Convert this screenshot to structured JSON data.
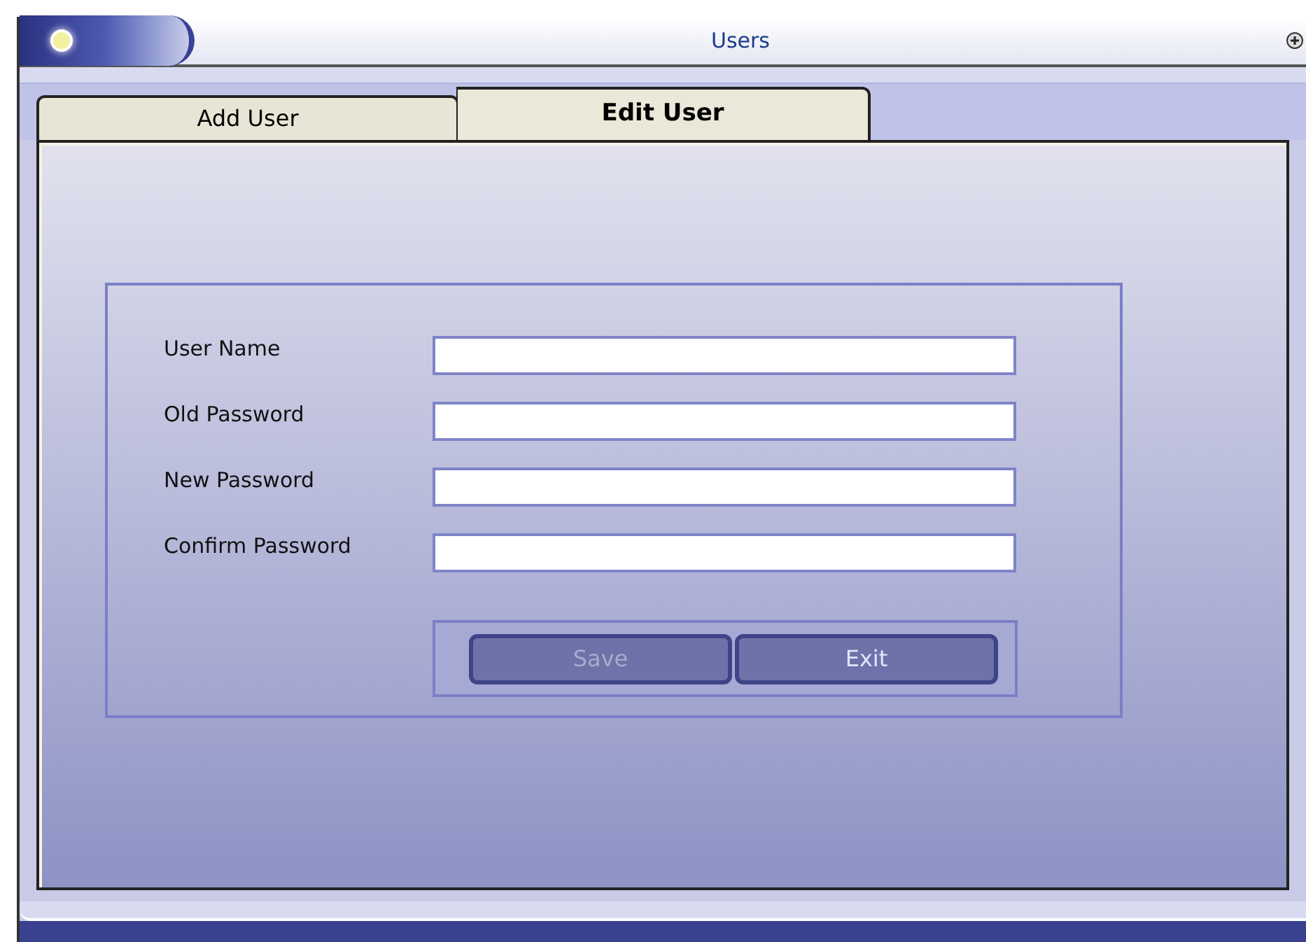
{
  "window": {
    "title": "Users"
  },
  "tabs": [
    {
      "label": "Add User",
      "selected": false
    },
    {
      "label": "Edit User",
      "selected": true
    }
  ],
  "fields": [
    {
      "label": "User Name"
    },
    {
      "label": "Old Password"
    },
    {
      "label": "New Password"
    },
    {
      "label": "Confirm Password"
    }
  ],
  "buttons": [
    {
      "label": "Save",
      "disabled": true
    },
    {
      "label": "Exit",
      "disabled": false
    }
  ]
}
